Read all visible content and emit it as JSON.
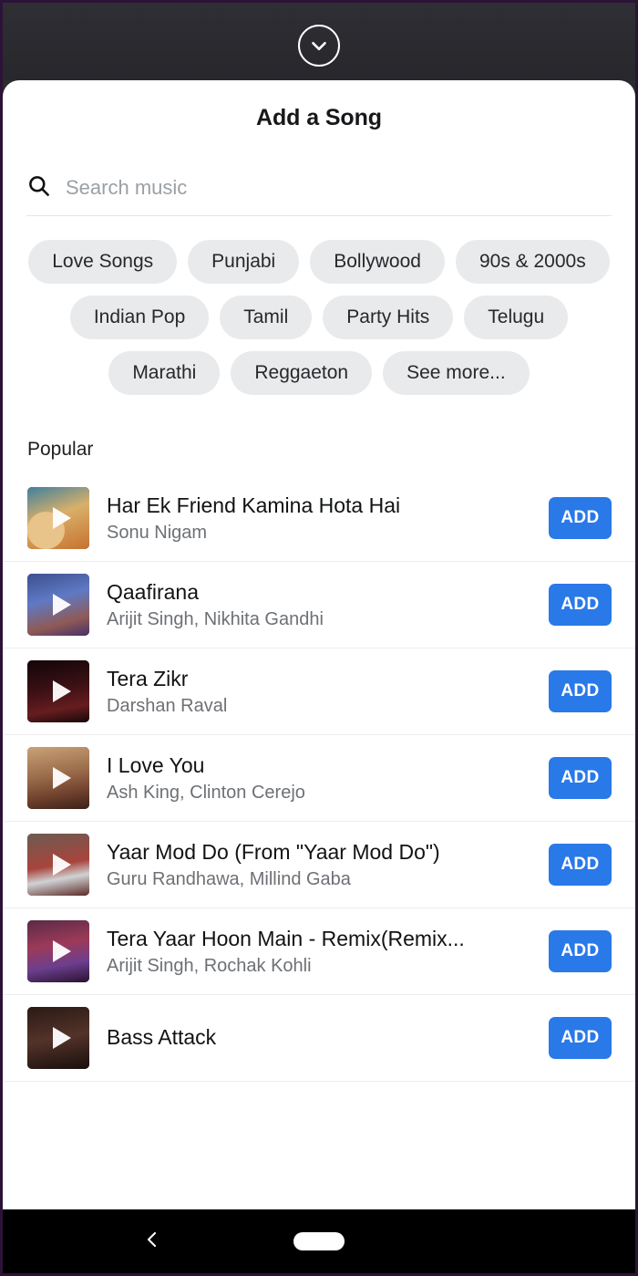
{
  "handle": {
    "icon": "chevron-down-icon"
  },
  "sheet": {
    "title": "Add a Song",
    "search": {
      "icon": "search-icon",
      "value": "",
      "placeholder": "Search music"
    },
    "chips": [
      {
        "label": "Love Songs"
      },
      {
        "label": "Punjabi"
      },
      {
        "label": "Bollywood"
      },
      {
        "label": "90s & 2000s"
      },
      {
        "label": "Indian Pop"
      },
      {
        "label": "Tamil"
      },
      {
        "label": "Party Hits"
      },
      {
        "label": "Telugu"
      },
      {
        "label": "Marathi"
      },
      {
        "label": "Reggaeton"
      },
      {
        "label": "See more..."
      }
    ],
    "section_label": "Popular",
    "add_label": "ADD",
    "songs": [
      {
        "title": "Har Ek Friend Kamina Hota Hai",
        "artist": "Sonu Nigam",
        "art": "art-a"
      },
      {
        "title": "Qaafirana",
        "artist": "Arijit Singh, Nikhita Gandhi",
        "art": "art-b"
      },
      {
        "title": "Tera Zikr",
        "artist": "Darshan Raval",
        "art": "art-c"
      },
      {
        "title": "I Love You",
        "artist": "Ash King, Clinton Cerejo",
        "art": "art-d"
      },
      {
        "title": "Yaar Mod Do (From \"Yaar Mod Do\")",
        "artist": "Guru Randhawa, Millind Gaba",
        "art": "art-e"
      },
      {
        "title": "Tera Yaar Hoon Main - Remix(Remix...",
        "artist": "Arijit Singh, Rochak Kohli",
        "art": "art-f"
      },
      {
        "title": "Bass Attack",
        "artist": "",
        "art": "art-g"
      }
    ]
  },
  "navbar": {
    "back_icon": "chevron-left-icon",
    "home_icon": "home-pill-icon"
  },
  "colors": {
    "accent": "#2979e8",
    "chip_bg": "#e9eaec",
    "backdrop": "#2b2b30",
    "navbar": "#000000"
  }
}
